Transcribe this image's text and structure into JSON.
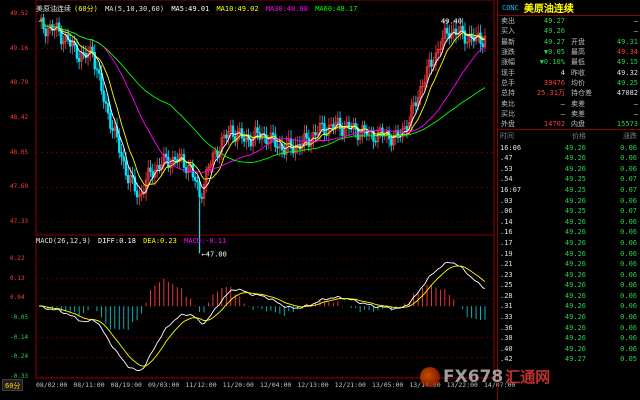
{
  "chart": {
    "name": "美原油连续",
    "period": "(60分)",
    "ma_prefix": "MA(5,10,30,60)",
    "ma5": "MA5:49.01",
    "ma10": "MA10:49.02",
    "ma30": "MA30:48.88",
    "ma60": "MA60:48.17",
    "price_levels": [
      "49.52",
      "49.16",
      "48.79",
      "48.42",
      "48.05",
      "47.69",
      "47.33"
    ],
    "high_label": "49.40",
    "low_label": "47.00",
    "colors": {
      "up": "#ff3b3b",
      "down": "#00e5ff",
      "ma5": "#ffffff",
      "ma10": "#ffff00",
      "ma30": "#ff00ff",
      "ma60": "#00ff00",
      "grid": "#8b0000"
    }
  },
  "macd": {
    "prefix": "MACD(26,12,9)",
    "diff": "DIFF:0.18",
    "dea": "DEA:0.23",
    "macd": "MACD:-0.11",
    "levels": [
      "0.22",
      "0.13",
      "0.04",
      "-0.05",
      "-0.14",
      "-0.24",
      "-0.33"
    ]
  },
  "xaxis": [
    "08/02:00",
    "08/11:00",
    "08/19:00",
    "09/03:00",
    "11/12:00",
    "11/20:00",
    "12/04:00",
    "12/13:00",
    "12/21:00",
    "13/05:00",
    "13/14:00",
    "13/22:00",
    "14/07:00"
  ],
  "period_button": "60分",
  "quote": {
    "code": "CONC",
    "name": "美原油连续",
    "rows": [
      {
        "l1": "卖出",
        "v1": "49.27",
        "c1": "c-green",
        "l2": "",
        "v2": "—",
        "c2": "c-white"
      },
      {
        "l1": "买入",
        "v1": "49.26",
        "c1": "c-green",
        "l2": "",
        "v2": "—",
        "c2": "c-white"
      },
      {
        "l1": "最新",
        "v1": "49.27",
        "c1": "c-green",
        "l2": "开盘",
        "v2": "49.31",
        "c2": "c-green"
      },
      {
        "l1": "涨跌",
        "v1": "▼0.05",
        "c1": "c-green",
        "l2": "最高",
        "v2": "49.34",
        "c2": "c-red"
      },
      {
        "l1": "涨幅",
        "v1": "▼0.10%",
        "c1": "c-green",
        "l2": "最低",
        "v2": "49.15",
        "c2": "c-green"
      },
      {
        "l1": "现手",
        "v1": "4",
        "c1": "c-white",
        "l2": "昨收",
        "v2": "49.32",
        "c2": "c-white"
      },
      {
        "l1": "总手",
        "v1": "39476",
        "c1": "c-red",
        "l2": "均价",
        "v2": "49.25",
        "c2": "c-green"
      },
      {
        "l1": "总持",
        "v1": "25.31万",
        "c1": "c-red",
        "l2": "持仓差",
        "v2": "47082",
        "c2": "c-white"
      },
      {
        "l1": "卖比",
        "v1": "—",
        "c1": "c-white",
        "l2": "卖差",
        "v2": "—",
        "c2": "c-white"
      },
      {
        "l1": "买比",
        "v1": "—",
        "c1": "c-white",
        "l2": "卖差",
        "v2": "—",
        "c2": "c-white"
      },
      {
        "l1": "外盘",
        "v1": "14702",
        "c1": "c-red",
        "l2": "内盘",
        "v2": "15573",
        "c2": "c-green"
      }
    ]
  },
  "ticks": {
    "headers": {
      "time": "时间",
      "price": "价格",
      "chg": "涨跌"
    },
    "rows": [
      {
        "time": "16:06",
        "price": "49.26",
        "chg": "0.06"
      },
      {
        "time": ".47",
        "price": "49.26",
        "chg": "0.06"
      },
      {
        "time": ".53",
        "price": "49.26",
        "chg": "0.06"
      },
      {
        "time": ".54",
        "price": "49.25",
        "chg": "0.07"
      },
      {
        "time": "16:07",
        "price": "49.25",
        "chg": "0.07"
      },
      {
        "time": ".03",
        "price": "49.26",
        "chg": "0.06"
      },
      {
        "time": ".06",
        "price": "49.25",
        "chg": "0.07"
      },
      {
        "time": ".14",
        "price": "49.26",
        "chg": "0.06"
      },
      {
        "time": ".16",
        "price": "49.26",
        "chg": "0.06"
      },
      {
        "time": ".17",
        "price": "49.26",
        "chg": "0.06"
      },
      {
        "time": ".19",
        "price": "49.26",
        "chg": "0.06"
      },
      {
        "time": ".21",
        "price": "49.26",
        "chg": "0.06"
      },
      {
        "time": ".23",
        "price": "49.26",
        "chg": "0.06"
      },
      {
        "time": ".25",
        "price": "49.26",
        "chg": "0.06"
      },
      {
        "time": ".28",
        "price": "49.26",
        "chg": "0.06"
      },
      {
        "time": ".31",
        "price": "49.26",
        "chg": "0.06"
      },
      {
        "time": ".33",
        "price": "49.26",
        "chg": "0.06"
      },
      {
        "time": ".36",
        "price": "49.26",
        "chg": "0.06"
      },
      {
        "time": ".38",
        "price": "49.26",
        "chg": "0.06"
      },
      {
        "time": ".40",
        "price": "49.26",
        "chg": "0.06"
      },
      {
        "time": ".42",
        "price": "49.27",
        "chg": "0.05"
      }
    ]
  },
  "watermark": {
    "text": "FX678",
    "cn": "汇通网"
  }
}
